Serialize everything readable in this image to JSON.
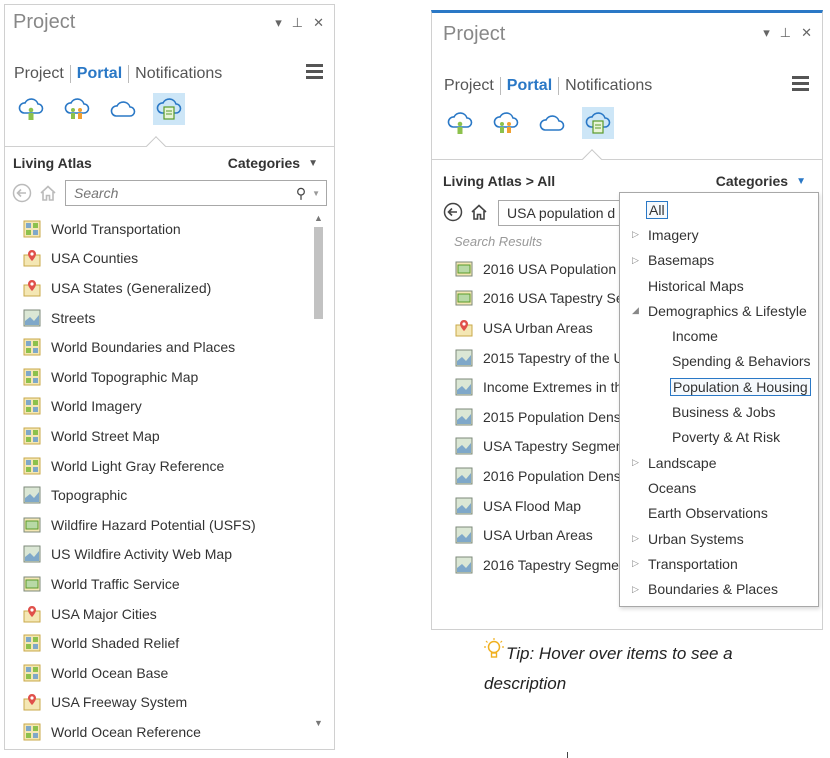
{
  "left_panel": {
    "title": "Project",
    "window_controls": {
      "menu": "▾",
      "pin": "⊥",
      "close": "✕"
    },
    "tabs": [
      {
        "label": "Project",
        "active": false
      },
      {
        "label": "Portal",
        "active": true
      },
      {
        "label": "Notifications",
        "active": false
      }
    ],
    "portal_icons": [
      "my-content-icon",
      "groups-icon",
      "all-portal-icon",
      "living-atlas-icon"
    ],
    "selected_portal_icon": "living-atlas-icon",
    "breadcrumb": "Living Atlas",
    "categories_label": "Categories",
    "search_placeholder": "Search",
    "items": [
      {
        "label": "World Transportation",
        "icon": "tile-layer-icon"
      },
      {
        "label": "USA Counties",
        "icon": "feature-layer-icon"
      },
      {
        "label": "USA States (Generalized)",
        "icon": "feature-layer-icon"
      },
      {
        "label": "Streets",
        "icon": "web-map-icon"
      },
      {
        "label": "World Boundaries and Places",
        "icon": "tile-layer-icon"
      },
      {
        "label": "World Topographic Map",
        "icon": "tile-layer-icon"
      },
      {
        "label": "World Imagery",
        "icon": "tile-layer-icon"
      },
      {
        "label": "World Street Map",
        "icon": "tile-layer-icon"
      },
      {
        "label": "World Light Gray Reference",
        "icon": "tile-layer-icon"
      },
      {
        "label": "Topographic",
        "icon": "web-map-icon"
      },
      {
        "label": "Wildfire Hazard Potential (USFS)",
        "icon": "map-image-layer-icon"
      },
      {
        "label": "US Wildfire Activity Web Map",
        "icon": "web-map-icon"
      },
      {
        "label": "World Traffic Service",
        "icon": "map-image-layer-icon"
      },
      {
        "label": "USA Major Cities",
        "icon": "feature-layer-icon"
      },
      {
        "label": "World Shaded Relief",
        "icon": "tile-layer-icon"
      },
      {
        "label": "World Ocean Base",
        "icon": "tile-layer-icon"
      },
      {
        "label": "USA Freeway System",
        "icon": "feature-layer-icon"
      },
      {
        "label": "World Ocean Reference",
        "icon": "tile-layer-icon"
      }
    ]
  },
  "right_panel": {
    "title": "Project",
    "window_controls": {
      "menu": "▾",
      "pin": "⊥",
      "close": "✕"
    },
    "tabs": [
      {
        "label": "Portal",
        "active": true
      },
      {
        "label": "Notifications",
        "active": false
      }
    ],
    "tab_project": "Project",
    "breadcrumb": "Living Atlas > All",
    "categories_label": "Categories",
    "search_value": "USA population d",
    "search_results_label": "Search Results",
    "items": [
      {
        "label": "2016 USA Population",
        "icon": "map-image-layer-icon"
      },
      {
        "label": "2016 USA Tapestry Se",
        "icon": "map-image-layer-icon"
      },
      {
        "label": "USA Urban Areas",
        "icon": "feature-layer-icon"
      },
      {
        "label": "2015 Tapestry of the U",
        "icon": "web-map-icon"
      },
      {
        "label": "Income Extremes in th",
        "icon": "web-map-icon"
      },
      {
        "label": "2015 Population Dens",
        "icon": "web-map-icon"
      },
      {
        "label": "USA Tapestry Segmen",
        "icon": "web-map-icon"
      },
      {
        "label": "2016 Population Dens",
        "icon": "web-map-icon"
      },
      {
        "label": "USA Flood Map",
        "icon": "web-map-icon"
      },
      {
        "label": "USA Urban Areas",
        "icon": "web-map-icon"
      },
      {
        "label": "2016 Tapestry Segmen",
        "icon": "web-map-icon"
      }
    ]
  },
  "categories_dropdown": {
    "options": [
      {
        "label": "All",
        "level": 0,
        "expander": "",
        "boxed": true
      },
      {
        "label": "Imagery",
        "level": 0,
        "expander": "▷",
        "boxed": false
      },
      {
        "label": "Basemaps",
        "level": 0,
        "expander": "▷",
        "boxed": false
      },
      {
        "label": "Historical Maps",
        "level": 0,
        "expander": "",
        "boxed": false
      },
      {
        "label": "Demographics & Lifestyle",
        "level": 0,
        "expander": "◢",
        "boxed": false
      },
      {
        "label": "Income",
        "level": 1,
        "expander": "",
        "boxed": false
      },
      {
        "label": "Spending & Behaviors",
        "level": 1,
        "expander": "",
        "boxed": false
      },
      {
        "label": "Population & Housing",
        "level": 1,
        "expander": "",
        "boxed": true
      },
      {
        "label": "Business & Jobs",
        "level": 1,
        "expander": "",
        "boxed": false
      },
      {
        "label": "Poverty & At Risk",
        "level": 1,
        "expander": "",
        "boxed": false
      },
      {
        "label": "Landscape",
        "level": 0,
        "expander": "▷",
        "boxed": false
      },
      {
        "label": "Oceans",
        "level": 0,
        "expander": "",
        "boxed": false
      },
      {
        "label": "Earth Observations",
        "level": 0,
        "expander": "",
        "boxed": false
      },
      {
        "label": "Urban Systems",
        "level": 0,
        "expander": "▷",
        "boxed": false
      },
      {
        "label": "Transportation",
        "level": 0,
        "expander": "▷",
        "boxed": false
      },
      {
        "label": "Boundaries & Places",
        "level": 0,
        "expander": "▷",
        "boxed": false
      }
    ]
  },
  "tip": {
    "icon": "lightbulb-icon",
    "text": "Tip: Hover over items to see a description"
  },
  "colors": {
    "accent": "#2a78c6",
    "selected_icon_bg": "#cde6f7",
    "scroll_thumb": "#c2c2c2"
  }
}
